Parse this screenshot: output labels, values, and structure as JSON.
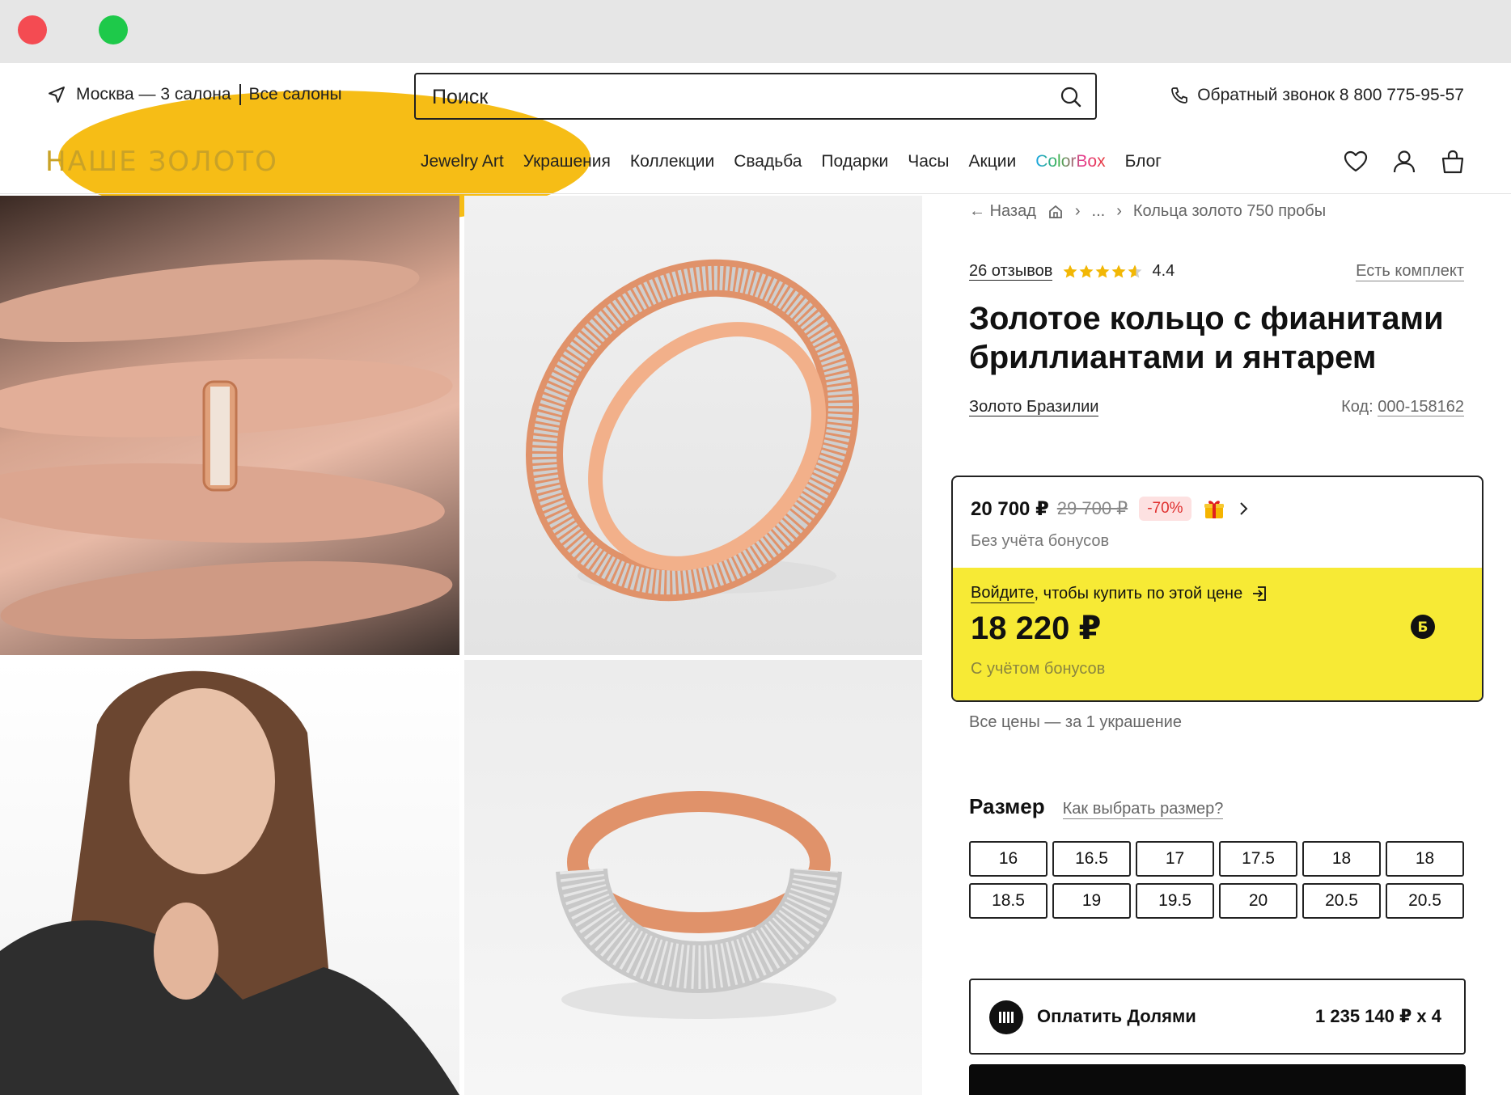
{
  "header": {
    "location": "Москва — 3 салона",
    "all_salons": "Все салоны",
    "search_placeholder": "Поиск",
    "callback": "Обратный звонок 8 800 775-95-57"
  },
  "nav": {
    "logo": "НАШЕ ЗОЛОТО",
    "items": [
      "Jewelry Art",
      "Украшения",
      "Коллекции",
      "Свадьба",
      "Подарки",
      "Часы",
      "Акции",
      "ColorBox",
      "Блог"
    ]
  },
  "icons": [
    "navigate-icon",
    "search-icon",
    "phone-icon",
    "heart-icon",
    "user-icon",
    "bag-icon",
    "home-icon",
    "star-icon",
    "gift-icon",
    "chevron-right-icon",
    "login-icon",
    "bonus-icon",
    "dolyami-icon"
  ],
  "product": {
    "back": "Назад",
    "ellipsis": "...",
    "category": "Кольца золото 750 пробы",
    "reviews": "26 отзывов",
    "rating": "4.4",
    "rating_value": 4.4,
    "set_link": "Есть комплект",
    "title": "Золотое кольцо с фианитами бриллиантами и янтарем",
    "brand": "Золото Бразилии",
    "code_label": "Код:",
    "code": "000-158162"
  },
  "price": {
    "current": "20 700 ₽",
    "old": "29 700 ₽",
    "discount": "-70%",
    "no_bonus": "Без учёта бонусов",
    "login_link": "Войдите",
    "login_text": ", чтобы купить по этой цене",
    "bonus_price": "18 220 ₽",
    "with_bonus": "С учётом бонусов",
    "all_prices": "Все цены — за 1 украшение"
  },
  "sizes": {
    "heading": "Размер",
    "how_to": "Как выбрать размер?",
    "values": [
      "16",
      "16.5",
      "17",
      "17.5",
      "18",
      "18",
      "18.5",
      "19",
      "19.5",
      "20",
      "20.5",
      "20.5"
    ]
  },
  "dolyami": {
    "label": "Оплатить Долями",
    "amount": "1 235 140 ₽ х 4"
  },
  "colors": {
    "brand_gold": "#c9a227",
    "bonus_yellow": "#f7ea35",
    "discount_red": "#e0302f"
  }
}
